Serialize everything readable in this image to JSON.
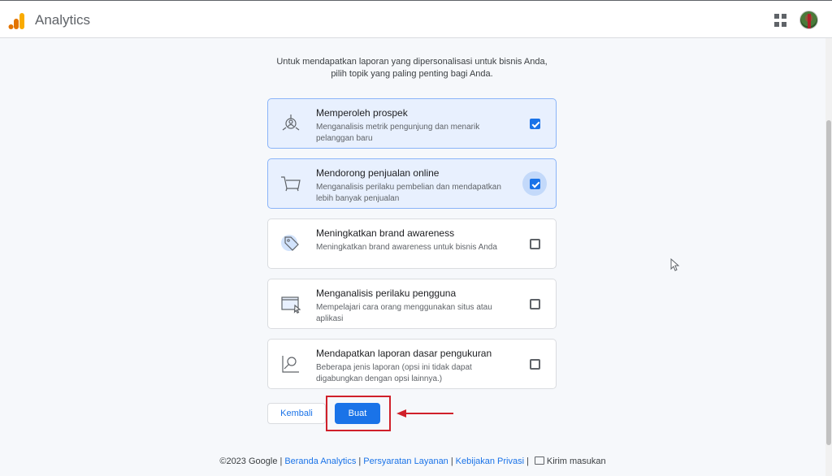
{
  "app": {
    "title": "Analytics"
  },
  "header": {
    "apps_icon": "apps-grid-icon",
    "avatar": "user-avatar"
  },
  "intro": {
    "line1": "Untuk mendapatkan laporan yang dipersonalisasi untuk bisnis Anda,",
    "line2": "pilih topik yang paling penting bagi Anda."
  },
  "options": [
    {
      "title": "Memperoleh prospek",
      "desc": "Menganalisis metrik pengunjung dan menarik pelanggan baru",
      "checked": true,
      "icon": "target-user-icon"
    },
    {
      "title": "Mendorong penjualan online",
      "desc": "Menganalisis perilaku pembelian dan mendapatkan lebih banyak penjualan",
      "checked": true,
      "icon": "shopping-cart-icon"
    },
    {
      "title": "Meningkatkan brand awareness",
      "desc": "Meningkatkan brand awareness untuk bisnis Anda",
      "checked": false,
      "icon": "tag-icon"
    },
    {
      "title": "Menganalisis perilaku pengguna",
      "desc": "Mempelajari cara orang menggunakan situs atau aplikasi",
      "checked": false,
      "icon": "screen-cursor-icon"
    },
    {
      "title": "Mendapatkan laporan dasar pengukuran",
      "desc": "Beberapa jenis laporan (opsi ini tidak dapat digabungkan dengan opsi lainnya.)",
      "checked": false,
      "icon": "magnifier-report-icon"
    }
  ],
  "buttons": {
    "back": "Kembali",
    "create": "Buat"
  },
  "footer": {
    "copyright": "©2023 Google",
    "links": [
      "Beranda Analytics",
      "Persyaratan Layanan",
      "Kebijakan Privasi"
    ],
    "feedback": "Kirim masukan"
  },
  "colors": {
    "accent": "#1a73e8",
    "selected_bg": "#e8f0fe",
    "annotation": "#d0202a"
  }
}
